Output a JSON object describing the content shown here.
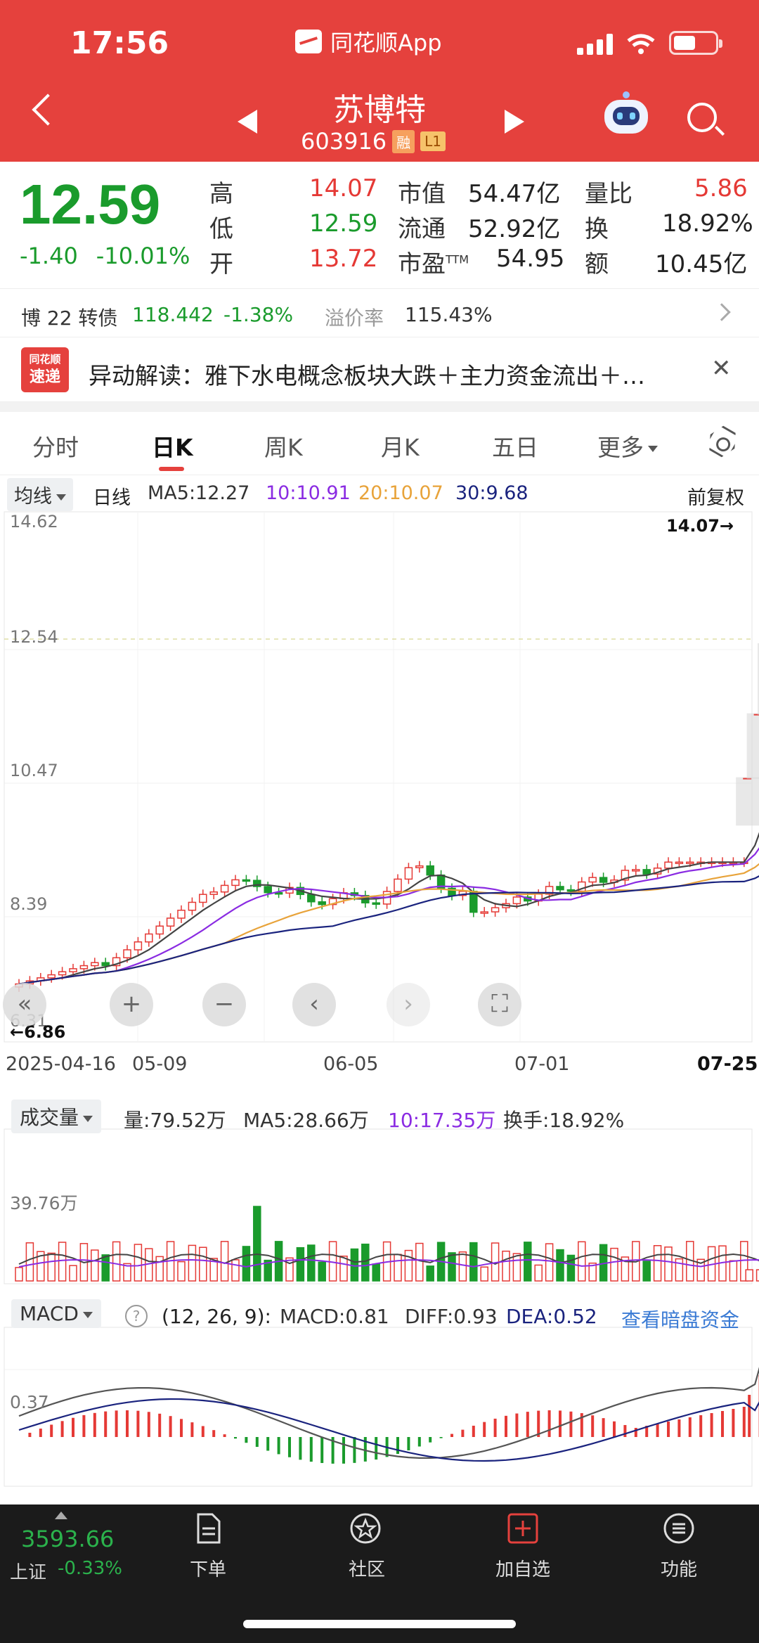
{
  "status_bar": {
    "time": "17:56",
    "app": "同花顺App"
  },
  "header": {
    "name": "苏博特",
    "code": "603916",
    "tag_margin": "融",
    "tag_level": "L1"
  },
  "quote": {
    "price": "12.59",
    "change": "-1.40",
    "change_pct": "-10.01%",
    "high_label": "高",
    "high": "14.07",
    "low_label": "低",
    "low": "12.59",
    "open_label": "开",
    "open": "13.72",
    "mcap_label": "市值",
    "mcap": "54.47亿",
    "float_label": "流通",
    "float": "52.92亿",
    "pe_label": "市盈",
    "pe_sup": "TTM",
    "pe": "54.95",
    "vr_label": "量比",
    "vr": "5.86",
    "turnover_label": "换",
    "turnover": "18.92%",
    "amount_label": "额",
    "amount": "10.45亿"
  },
  "bond": {
    "name": "博 22 转债",
    "price": "118.442",
    "pct": "-1.38%",
    "premium_label": "溢价率",
    "premium": "115.43%"
  },
  "news": {
    "logo_top": "同花顺",
    "logo_bottom": "速递",
    "text": "异动解读：雅下水电概念板块大跌＋主力资金流出＋…"
  },
  "tabs": [
    "分时",
    "日K",
    "周K",
    "月K",
    "五日",
    "更多"
  ],
  "ma_legend": {
    "selector": "均线",
    "period": "日线",
    "ma5": "MA5:12.27",
    "ma10": "10:10.91",
    "ma20": "20:10.07",
    "ma30": "30:9.68",
    "adjust": "前复权"
  },
  "kline_axis": {
    "y_labels": [
      "14.62",
      "12.54",
      "10.47",
      "8.39",
      "6.31"
    ],
    "high_marker": "14.07→",
    "low_marker": "←6.86",
    "dates": [
      "2025-04-16",
      "05-09",
      "06-05",
      "07-01",
      "07-25"
    ]
  },
  "volume": {
    "selector": "成交量",
    "vol": "量:79.52万",
    "ma5": "MA5:28.66万",
    "ma10": "10:17.35万",
    "turnover": "换手:18.92%",
    "y_label": "39.76万"
  },
  "macd": {
    "selector": "MACD",
    "params": "(12, 26, 9):",
    "macd": "MACD:0.81",
    "diff": "DIFF:0.93",
    "dea": "DEA:0.52",
    "link": "查看暗盘资金",
    "y_label": "0.37"
  },
  "bottom_bar": {
    "index_value": "3593.66",
    "index_name": "上证",
    "index_change": "-0.33%",
    "items": [
      "下单",
      "社区",
      "加自选",
      "功能"
    ]
  },
  "colors": {
    "header_red": "#e5413d",
    "down_green": "#1a9b2c",
    "up_red": "#e53935",
    "ma10_purple": "#8a2be2",
    "ma20_orange": "#e8a33a",
    "ma30_navy": "#1a237e"
  },
  "chart_data": {
    "type": "candlestick",
    "title": "",
    "ylim": [
      6.31,
      14.62
    ],
    "x_ticks": [
      "2025-04-16",
      "05-09",
      "06-05",
      "07-01",
      "07-25"
    ],
    "last_bar": {
      "date": "07-25",
      "open": 13.72,
      "high": 14.07,
      "low": 12.59,
      "close": 12.59
    },
    "ma": {
      "MA5": 12.27,
      "MA10": 10.91,
      "MA20": 10.07,
      "MA30": 9.68
    },
    "volume_last": "79.52万",
    "macd_last": {
      "MACD": 0.81,
      "DIFF": 0.93,
      "DEA": 0.52
    }
  }
}
